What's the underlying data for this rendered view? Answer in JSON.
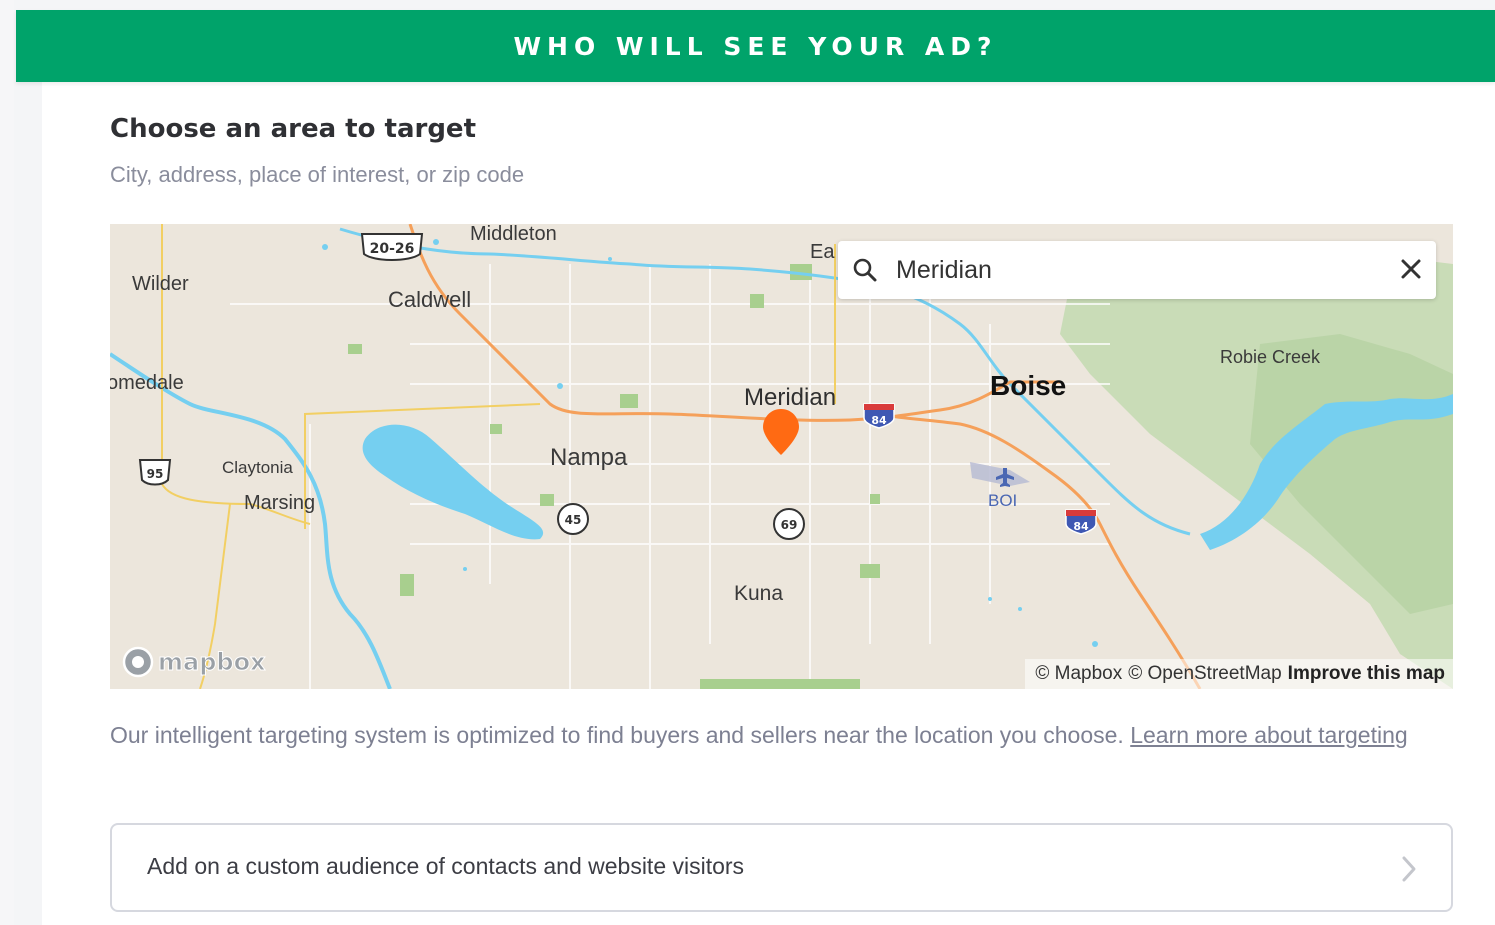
{
  "banner": {
    "title": "WHO WILL SEE YOUR AD?"
  },
  "target": {
    "title": "Choose an area to target",
    "subtitle": "City, address, place of interest, or zip code"
  },
  "map": {
    "search": {
      "value": "Meridian",
      "icon": "search-icon",
      "clear_icon": "close-icon"
    },
    "places": {
      "wilder": "Wilder",
      "homedale": "omedale",
      "middleton": "Middleton",
      "caldwell": "Caldwell",
      "eagle": "Ea",
      "meridian": "Meridian",
      "boise": "Boise",
      "nampa": "Nampa",
      "claytonia": "Claytonia",
      "marsing": "Marsing",
      "kuna": "Kuna",
      "robie_creek": "Robie Creek",
      "airport": "BOI"
    },
    "route_shields": {
      "us20_26": "20-26",
      "i84_west": "84",
      "i84_east": "84",
      "us95": "95",
      "sh45": "45",
      "sh69": "69"
    },
    "attribution": {
      "mapbox": "© Mapbox",
      "osm": "© OpenStreetMap",
      "improve": "Improve this map"
    },
    "logo_text": "mapbox",
    "marker_icon": "map-pin-icon",
    "colors": {
      "marker": "#ff6a13",
      "water": "#75cff0",
      "highway": "#f5a05a",
      "park": "#a8cf8e"
    }
  },
  "description": {
    "text": "Our intelligent targeting system is optimized to find buyers and sellers near the location you choose. ",
    "link": "Learn more about targeting"
  },
  "custom_audience": {
    "label": "Add on a custom audience of contacts and website visitors",
    "icon": "chevron-right-icon"
  },
  "colors": {
    "brand": "#00a36a",
    "muted_text": "#8a8d9c"
  }
}
